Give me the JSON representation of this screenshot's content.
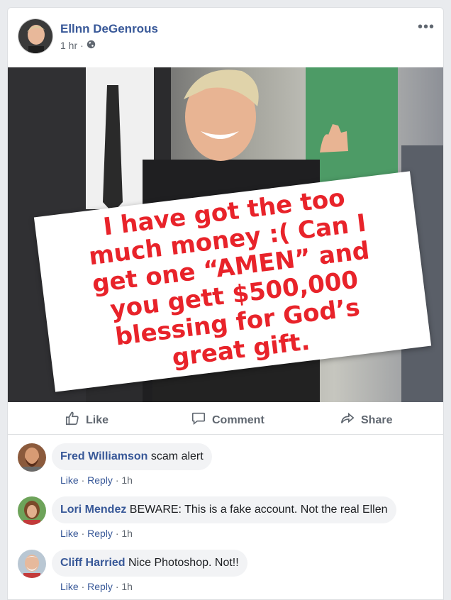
{
  "post": {
    "author": "Ellnn DeGenrous",
    "time": "1 hr",
    "sign_text": "I have got the too much money :( Can I get one “AMEN” and you gett $500,000 blessing for God’s great gift."
  },
  "actions": {
    "like": "Like",
    "comment": "Comment",
    "share": "Share"
  },
  "comments": [
    {
      "name": "Fred Williamson",
      "text": "scam alert",
      "like": "Like",
      "reply": "Reply",
      "time": "1h"
    },
    {
      "name": "Lori Mendez",
      "text": "BEWARE: This is a fake account. Not the real Ellen",
      "like": "Like",
      "reply": "Reply",
      "time": "1h"
    },
    {
      "name": "Cliff Harried",
      "text": "Nice Photoshop. Not!!",
      "like": "Like",
      "reply": "Reply",
      "time": "1h"
    }
  ],
  "separator": "·",
  "colors": {
    "link_blue": "#385898",
    "sign_red": "#e8232a",
    "muted": "#606770"
  },
  "icons": [
    "globe-icon",
    "more-options-icon",
    "thumbs-up-icon",
    "comment-icon",
    "share-icon"
  ]
}
